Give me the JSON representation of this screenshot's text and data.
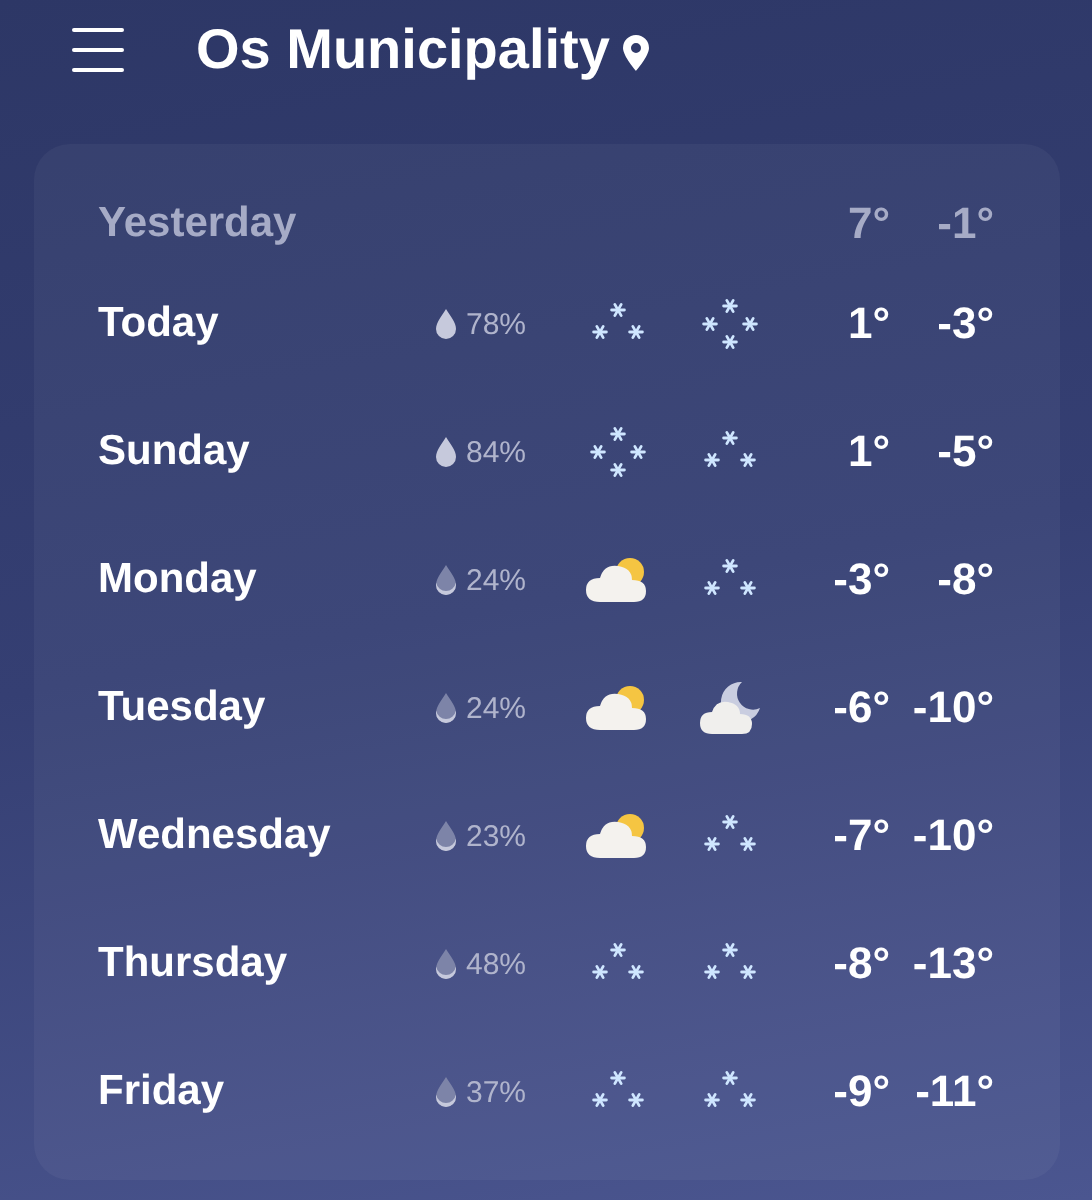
{
  "header": {
    "title": "Os Municipality"
  },
  "yesterday": {
    "label": "Yesterday",
    "high": "7°",
    "low": "-1°"
  },
  "days": [
    {
      "day": "Today",
      "drop": {
        "kind": "full"
      },
      "precip": "78%",
      "day_icon": {
        "kind": "snow"
      },
      "night_icon": {
        "kind": "heavy_snow"
      },
      "high": "1°",
      "low": "-3°"
    },
    {
      "day": "Sunday",
      "drop": {
        "kind": "full"
      },
      "precip": "84%",
      "day_icon": {
        "kind": "heavy_snow"
      },
      "night_icon": {
        "kind": "snow"
      },
      "high": "1°",
      "low": "-5°"
    },
    {
      "day": "Monday",
      "drop": {
        "kind": "half"
      },
      "precip": "24%",
      "day_icon": {
        "kind": "partly_cloudy_day"
      },
      "night_icon": {
        "kind": "snow"
      },
      "high": "-3°",
      "low": "-8°"
    },
    {
      "day": "Tuesday",
      "drop": {
        "kind": "half"
      },
      "precip": "24%",
      "day_icon": {
        "kind": "partly_cloudy_day"
      },
      "night_icon": {
        "kind": "partly_cloudy_night"
      },
      "high": "-6°",
      "low": "-10°"
    },
    {
      "day": "Wednesday",
      "drop": {
        "kind": "half"
      },
      "precip": "23%",
      "day_icon": {
        "kind": "partly_cloudy_day"
      },
      "night_icon": {
        "kind": "snow"
      },
      "high": "-7°",
      "low": "-10°"
    },
    {
      "day": "Thursday",
      "drop": {
        "kind": "half"
      },
      "precip": "48%",
      "day_icon": {
        "kind": "snow"
      },
      "night_icon": {
        "kind": "snow"
      },
      "high": "-8°",
      "low": "-13°"
    },
    {
      "day": "Friday",
      "drop": {
        "kind": "half"
      },
      "precip": "37%",
      "day_icon": {
        "kind": "snow"
      },
      "night_icon": {
        "kind": "snow"
      },
      "high": "-9°",
      "low": "-11°"
    }
  ]
}
